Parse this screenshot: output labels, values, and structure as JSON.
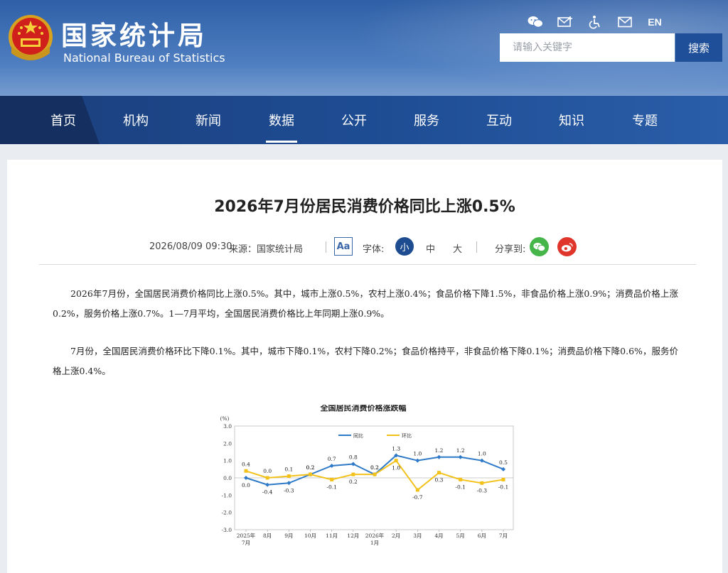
{
  "header": {
    "site_name_cn": "国家统计局",
    "site_name_en": "National Bureau of Statistics",
    "tools": {
      "en_label": "EN"
    },
    "search": {
      "placeholder": "请输入关键字",
      "button_label": "搜索"
    }
  },
  "nav": {
    "items": [
      "首页",
      "机构",
      "新闻",
      "数据",
      "公开",
      "服务",
      "互动",
      "知识",
      "专题"
    ],
    "active_index": 3
  },
  "article": {
    "title": "2026年7月份居民消费价格同比上涨0.5%",
    "date": "2026/08/09 09:30",
    "source": "来源：国家统计局",
    "aa_label": "Aa",
    "font_label": "字体:",
    "size_small": "小",
    "size_medium": "中",
    "size_large": "大",
    "share_label": "分享到:",
    "paragraphs": [
      "2026年7月份，全国居民消费价格同比上涨0.5%。其中，城市上涨0.5%，农村上涨0.4%；食品价格下降1.5%，非食品价格上涨0.9%；消费品价格上涨0.2%，服务价格上涨0.7%。1—7月平均，全国居民消费价格比上年同期上涨0.9%。",
      "7月份，全国居民消费价格环比下降0.1%。其中，城市下降0.1%，农村下降0.2%；食品价格持平，非食品价格下降0.1%；消费品价格下降0.6%，服务价格上涨0.4%。"
    ]
  },
  "colors": {
    "nav_dark": "#1b3f7c",
    "accent_blue": "#1d4c91",
    "series_yoy": "#2f7ac8",
    "series_mom": "#f2c21b",
    "wechat": "#46b64a",
    "weibo": "#e0352b"
  },
  "chart_data": {
    "type": "line",
    "title": "全国居民消费价格涨跌幅",
    "ylabel": "(%)",
    "ylim": [
      -3.0,
      3.0
    ],
    "yticks": [
      "3.0",
      "2.0",
      "1.0",
      "0.0",
      "-1.0",
      "-2.0",
      "-3.0"
    ],
    "categories": [
      [
        "2025年",
        "7月"
      ],
      [
        "8月"
      ],
      [
        "9月"
      ],
      [
        "10月"
      ],
      [
        "11月"
      ],
      [
        "12月"
      ],
      [
        "2026年",
        "1月"
      ],
      [
        "2月"
      ],
      [
        "3月"
      ],
      [
        "4月"
      ],
      [
        "5月"
      ],
      [
        "6月"
      ],
      [
        "7月"
      ]
    ],
    "legend_position": "top",
    "series": [
      {
        "name": "同比",
        "values": [
          0.0,
          -0.4,
          -0.3,
          0.2,
          0.7,
          0.8,
          0.2,
          1.3,
          1.0,
          1.2,
          1.2,
          1.0,
          0.5
        ]
      },
      {
        "name": "环比",
        "values": [
          0.4,
          0.0,
          0.1,
          0.2,
          -0.1,
          0.2,
          0.2,
          1.0,
          -0.7,
          0.3,
          -0.1,
          -0.3,
          -0.1
        ]
      }
    ]
  }
}
